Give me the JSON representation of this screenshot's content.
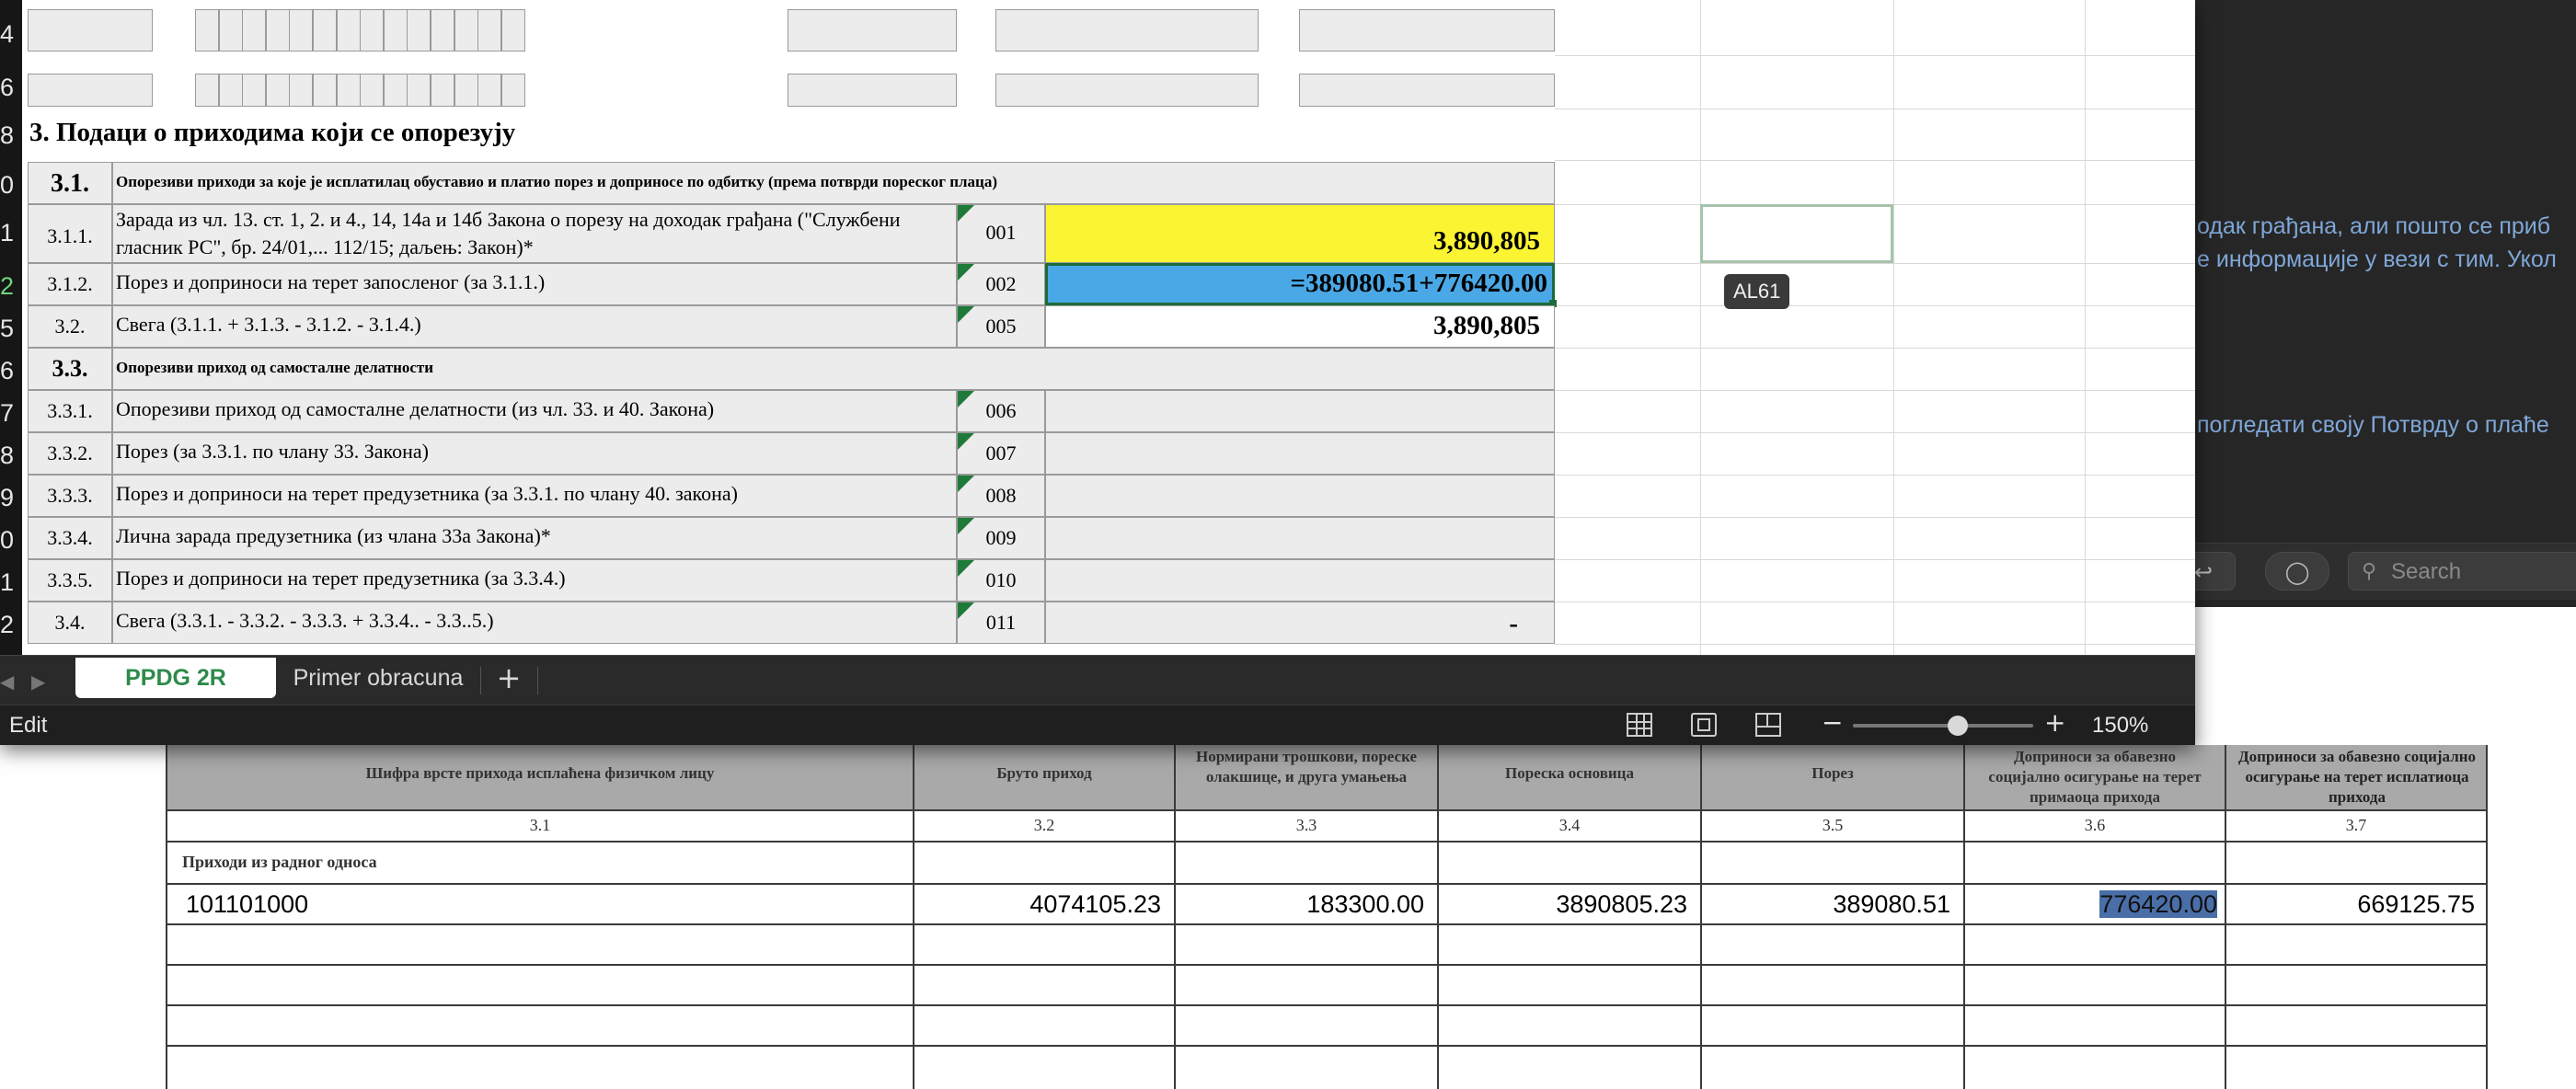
{
  "background_app": {
    "lines": [
      "одак грађана, али пошто се приб",
      "е информације у вези с тим. Укол",
      "погледати своју Потврду о плаће"
    ],
    "search_placeholder": "Search",
    "back_icon": "share-back-icon",
    "markup_icon": "markup-pen-icon"
  },
  "spreadsheet": {
    "row_numbers": [
      "4",
      "6",
      "8",
      "0",
      "1",
      "2",
      "5",
      "6",
      "7",
      "8",
      "9",
      "0",
      "1",
      "2"
    ],
    "selected_row": "2",
    "section_title": "3. Подаци о приходима који се опорезују",
    "rows": [
      {
        "num": "3.1.",
        "label": "Опорезиви приходи за које је исплатилац обуставио и платио порез и доприносе по одбитку (према потврди пореског плаца)"
      },
      {
        "num": "3.1.1.",
        "label_line1": "Зарада из чл. 13. ст. 1, 2. и 4., 14, 14а и 14б Закона о порезу на доходак грађана (\"Службени",
        "label_line2": "гласник РС\", бр. 24/01,... 112/15; даљењ: Закон)*",
        "code": "001",
        "value": "3,890,805"
      },
      {
        "num": "3.1.2.",
        "label": "Порез и доприноси на терет запосленог  (за 3.1.1.)",
        "code": "002",
        "value": "=389080.51+776420.00"
      },
      {
        "num": "3.2.",
        "label": "Свега (3.1.1. + 3.1.3. - 3.1.2. - 3.1.4.)",
        "code": "005",
        "value": "3,890,805"
      },
      {
        "num": "3.3.",
        "label": "Опорезиви приход од самосталне делатности"
      },
      {
        "num": "3.3.1.",
        "label": "Опорезиви приход од самосталне делатности (из чл. 33. и 40. Закона)",
        "code": "006",
        "value": ""
      },
      {
        "num": "3.3.2.",
        "label": "Порез (за 3.3.1. по члану 33. Закона)",
        "code": "007",
        "value": ""
      },
      {
        "num": "3.3.3.",
        "label": "Порез и доприноси на терет предузетника (за 3.3.1. по члану 40. закона)",
        "code": "008",
        "value": ""
      },
      {
        "num": "3.3.4.",
        "label": "Лична зарада предузетника (из члана 33а Закона)*",
        "code": "009",
        "value": ""
      },
      {
        "num": "3.3.5.",
        "label": "Порез и доприноси на терет предузетника (за 3.3.4.)",
        "code": "010",
        "value": ""
      },
      {
        "num": "3.4.",
        "label": "Свега (3.3.1. - 3.3.2. - 3.3.3. + 3.3.4.. - 3.3..5.)",
        "code": "011",
        "value": "-"
      }
    ],
    "cell_tooltip": "AL61",
    "tabs": [
      "PPDG 2R",
      "Primer obracuna"
    ],
    "active_tab": "PPDG 2R",
    "add_tab_label": "+",
    "status_mode": "Edit",
    "zoom_label": "150%",
    "zoom_level": 0.58
  },
  "pdf_table": {
    "headers": [
      "Шифра врсте прихода исплаћена физичком лицу",
      "Бруто приход",
      "Нормирани трошкови, пореске олакшице, и друга умањења",
      "Пореска основица",
      "Порез",
      "Доприноси за обавезно социјално осигурање на терет примаоца прихода",
      "Доприноси за обавезно социјално осигурање на терет исплатиоца прихода"
    ],
    "column_numbers": [
      "3.1",
      "3.2",
      "3.3",
      "3.4",
      "3.5",
      "3.6",
      "3.7"
    ],
    "section_label": "Приходи из радног односа",
    "row": [
      "101101000",
      "4074105.23",
      "183300.00",
      "3890805.23",
      "389080.51",
      "776420.00",
      "669125.75"
    ],
    "highlighted_value": "776420.00"
  }
}
